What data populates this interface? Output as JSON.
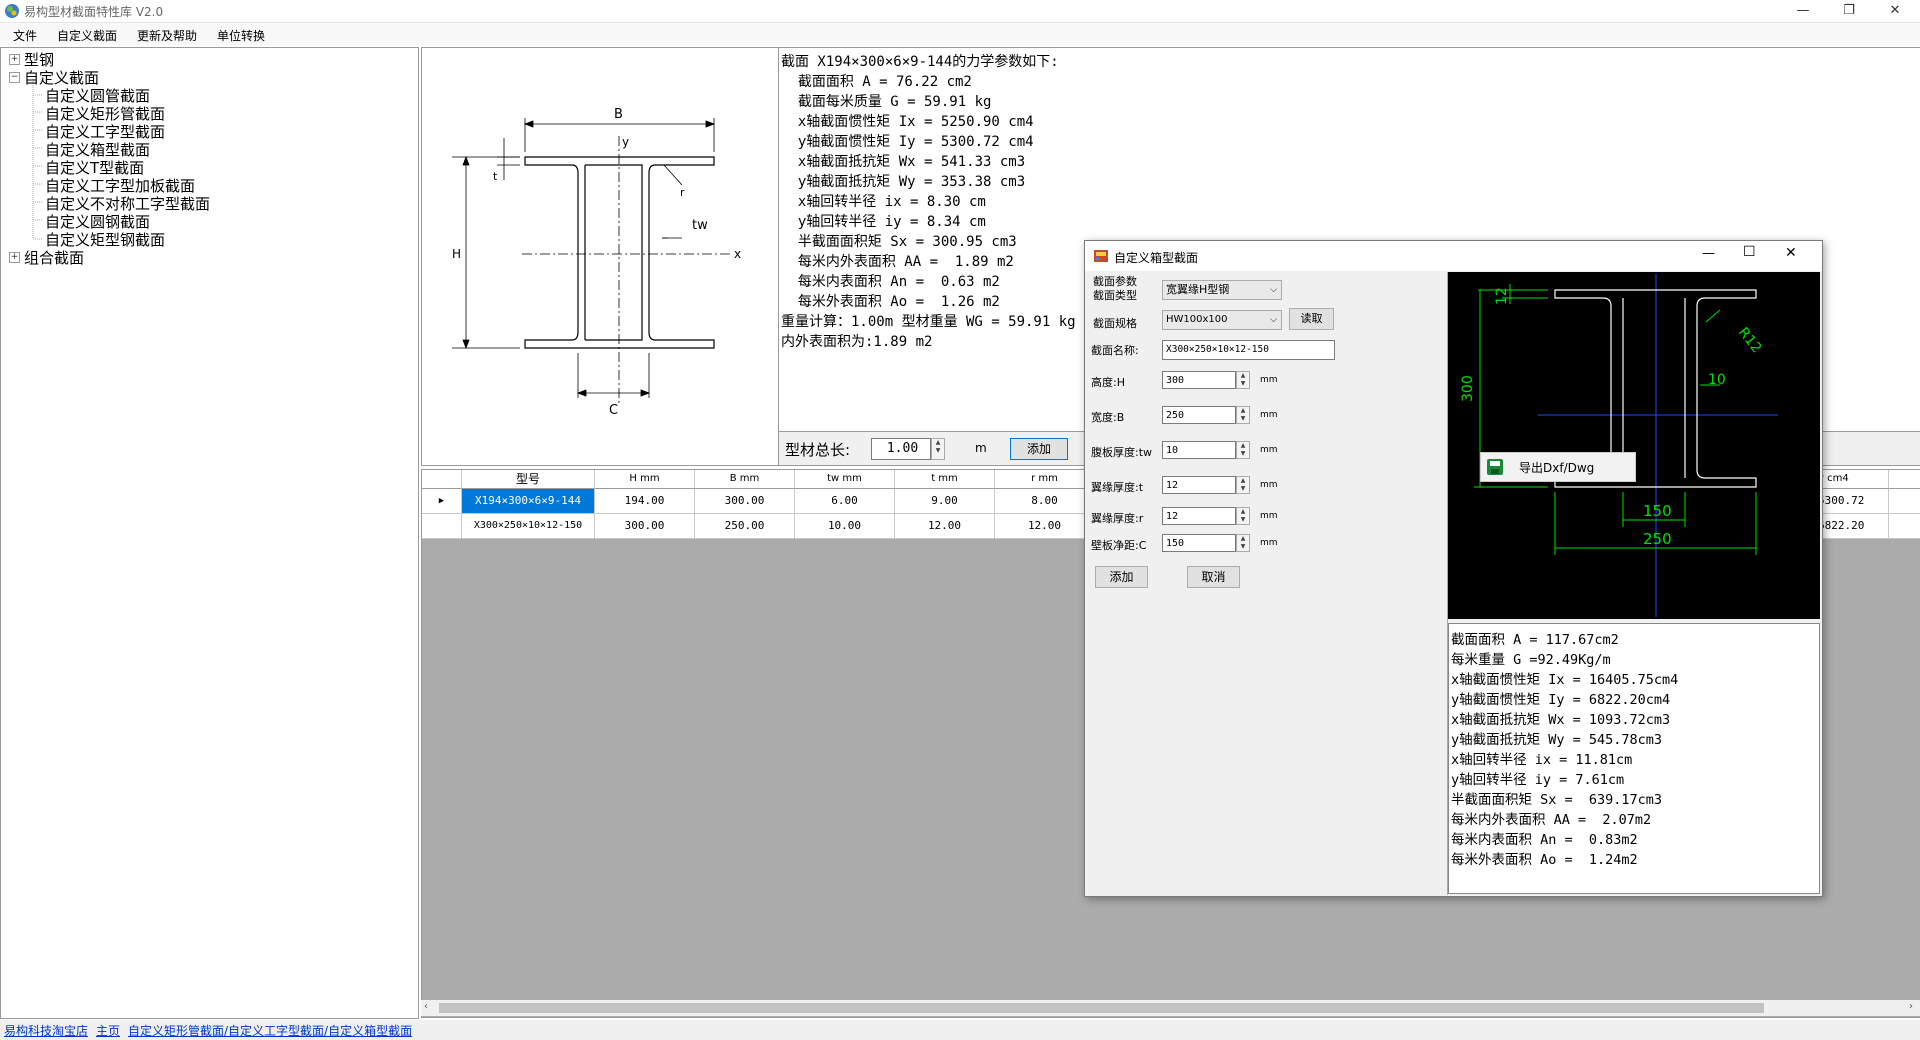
{
  "window": {
    "title": "易构型材截面特性库 V2.0",
    "buttons": {
      "minimize": "—",
      "maximize": "❐",
      "close": "✕"
    }
  },
  "menu": [
    "文件",
    "自定义截面",
    "更新及帮助",
    "单位转换"
  ],
  "tree": {
    "roots": [
      {
        "label": "型钢",
        "expander": "+"
      },
      {
        "label": "自定义截面",
        "expander": "−"
      },
      {
        "label": "组合截面",
        "expander": "+"
      }
    ],
    "children": [
      "自定义圆管截面",
      "自定义矩形管截面",
      "自定义工字型截面",
      "自定义箱型截面",
      "自定义T型截面",
      "自定义工字型加板截面",
      "自定义不对称工字型截面",
      "自定义圆钢截面",
      "自定义矩型钢截面"
    ]
  },
  "drawing": {
    "B": "B",
    "y": "y",
    "H": "H",
    "x": "x",
    "C": "C",
    "tw": "tw",
    "t": "t",
    "r": "r"
  },
  "result_lines": [
    "截面 X194×300×6×9-144的力学参数如下:",
    "  截面面积 A = 76.22 cm2",
    "  截面每米质量 G = 59.91 kg",
    "  x轴截面惯性矩 Ix = 5250.90 cm4",
    "  y轴截面惯性矩 Iy = 5300.72 cm4",
    "  x轴截面抵抗矩 Wx = 541.33 cm3",
    "  y轴截面抵抗矩 Wy = 353.38 cm3",
    "  x轴回转半径 ix = 8.30 cm",
    "  y轴回转半径 iy = 8.34 cm",
    "  半截面面积矩 Sx = 300.95 cm3",
    "  每米内外表面积 AA =  1.89 m2",
    "  每米内表面积 An =  0.63 m2",
    "  每米外表面积 Ao =  1.26 m2",
    "重量计算：1.00m 型材重量 WG = 59.91 kg",
    "内外表面积为:1.89 m2"
  ],
  "length_bar": {
    "label": "型材总长:",
    "value": "1.00",
    "unit": "m",
    "add_button": "添加"
  },
  "grid": {
    "columns": [
      "型号",
      "H mm",
      "B mm",
      "tw mm",
      "t mm",
      "r mm",
      "y cm4"
    ],
    "rows": [
      {
        "model": "X194×300×6×9-144",
        "H": "194.00",
        "B": "300.00",
        "tw": "6.00",
        "t": "9.00",
        "r": "8.00",
        "Iy": "5300.72",
        "selected": true
      },
      {
        "model": "X300×250×10×12-150",
        "H": "300.00",
        "B": "250.00",
        "tw": "10.00",
        "t": "12.00",
        "r": "12.00",
        "Iy": "6822.20",
        "selected": false
      }
    ],
    "row_pointer": "▶"
  },
  "status_links": [
    "易构科技淘宝店",
    "主页",
    "自定义矩形管截面/自定义工字型截面/自定义箱型截面"
  ],
  "dialog": {
    "title": "自定义箱型截面",
    "labels": {
      "section_param": "截面参数",
      "section_type": "截面类型",
      "section_spec": "截面规格",
      "section_name": "截面名称:",
      "height": "高度:H",
      "width": "宽度:B",
      "web": "腹板厚度:tw",
      "flange": "翼缘厚度:t",
      "flange_r": "翼缘厚度:r",
      "clear": "壁板净距:C"
    },
    "section_type_value": "宽翼缘H型钢",
    "section_spec_value": "HW100x100",
    "read_button": "读取",
    "section_name_value": "X300×250×10×12-150",
    "values": {
      "height": "300",
      "width": "250",
      "web": "10",
      "flange": "12",
      "flange_r": "12",
      "clear": "150"
    },
    "unit": "mm",
    "add_button": "添加",
    "cancel_button": "取消",
    "cad": {
      "dim_t": "12",
      "dim_r": "R12",
      "dim_h": "300",
      "dim_tw": "10",
      "dim_c": "150",
      "dim_b": "250"
    },
    "context_menu_item": "导出Dxf/Dwg",
    "result_lines": [
      "截面面积 A = 117.67cm2",
      "每米重量 G =92.49Kg/m",
      "x轴截面惯性矩 Ix = 16405.75cm4",
      "y轴截面惯性矩 Iy = 6822.20cm4",
      "x轴截面抵抗矩 Wx = 1093.72cm3",
      "y轴截面抵抗矩 Wy = 545.78cm3",
      "x轴回转半径 ix = 11.81cm",
      "y轴回转半径 iy = 7.61cm",
      "半截面面积矩 Sx =  639.17cm3",
      "每米内外表面积 AA =  2.07m2",
      "每米内表面积 An =  0.83m2",
      "每米外表面积 Ao =  1.24m2"
    ]
  }
}
